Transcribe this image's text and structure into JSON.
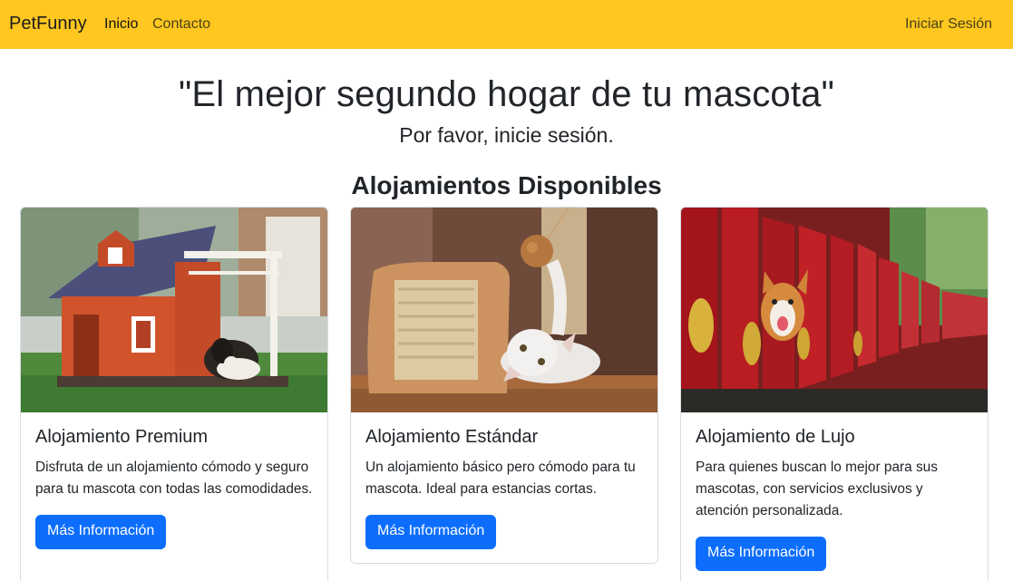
{
  "navbar": {
    "brand": "PetFunny",
    "links": [
      {
        "label": "Inicio"
      },
      {
        "label": "Contacto"
      }
    ],
    "login_label": "Iniciar Sesión",
    "background": "#ffc720"
  },
  "hero": {
    "title": "\"El mejor segundo hogar de tu mascota\"",
    "subtitle": "Por favor, inicie sesión."
  },
  "section": {
    "title": "Alojamientos Disponibles"
  },
  "cards": [
    {
      "title": "Alojamiento Premium",
      "text": "Disfruta de un alojamiento cómodo y seguro para tu mascota con todas las comodidades.",
      "button": "Más Información",
      "image": "dog-house-with-spaniel"
    },
    {
      "title": "Alojamiento Estándar",
      "text": "Un alojamiento básico pero cómodo para tu mascota. Ideal para estancias cortas.",
      "button": "Más Información",
      "image": "kitten-with-scratching-post"
    },
    {
      "title": "Alojamiento de Lujo",
      "text": "Para quienes buscan lo mejor para sus mascotas, con servicios exclusivos y atención personalizada.",
      "button": "Más Información",
      "image": "corgi-behind-red-fence"
    }
  ],
  "accent_color": "#0d6efd"
}
